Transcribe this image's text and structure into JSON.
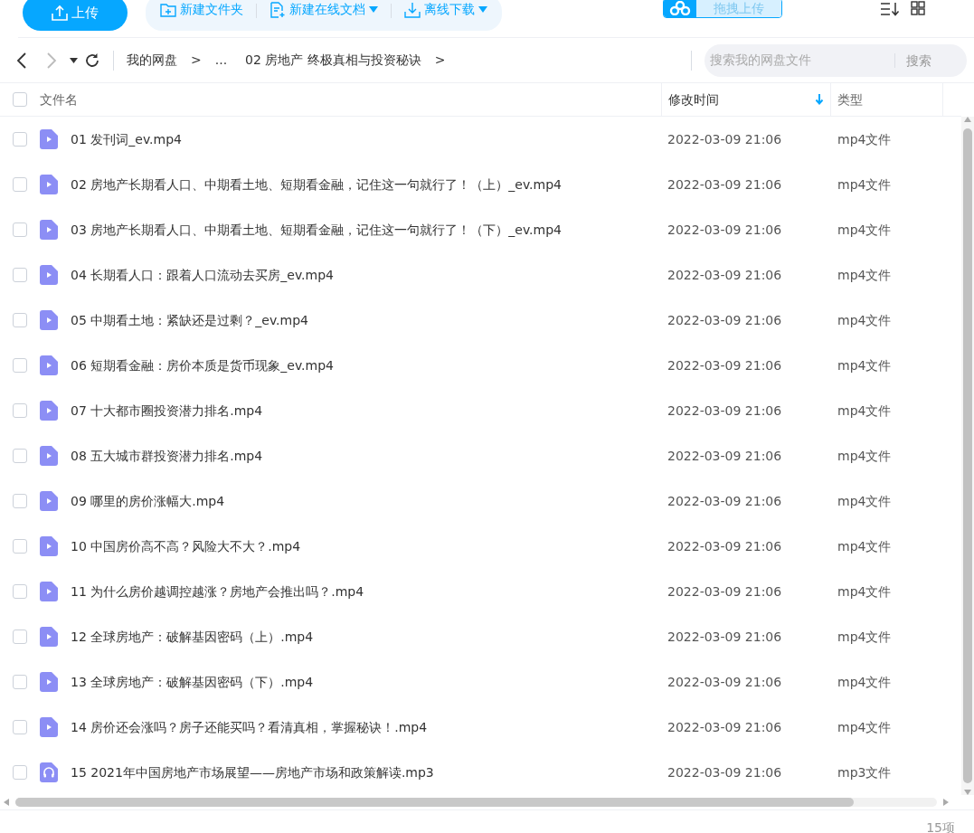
{
  "toolbar": {
    "upload": "上传",
    "actions": [
      {
        "kind": "folder",
        "label": "新建文件夹",
        "dropdown": false
      },
      {
        "kind": "doc",
        "label": "新建在线文档",
        "dropdown": true
      },
      {
        "kind": "download",
        "label": "离线下载",
        "dropdown": true
      }
    ],
    "drag_upload": "拖拽上传"
  },
  "nav": {
    "breadcrumb": [
      "我的网盘",
      ">",
      "...",
      "02 房地产 终极真相与投资秘诀",
      ">"
    ],
    "search": {
      "placeholder": "搜索我的网盘文件",
      "button": "搜索"
    }
  },
  "table": {
    "select_all_checked": false,
    "columns": [
      {
        "label": "文件名",
        "sorted": false
      },
      {
        "label": "修改时间",
        "sorted": true
      },
      {
        "label": "类型",
        "sorted": false
      }
    ],
    "rows": [
      {
        "name": "01 发刊词_ev.mp4",
        "kind": "video",
        "time": "2022-03-09 21:06",
        "type": "mp4文件",
        "checked": false
      },
      {
        "name": "02 房地产长期看人口、中期看土地、短期看金融，记住这一句就行了！（上）_ev.mp4",
        "kind": "video",
        "time": "2022-03-09 21:06",
        "type": "mp4文件",
        "checked": false
      },
      {
        "name": "03 房地产长期看人口、中期看土地、短期看金融，记住这一句就行了！（下）_ev.mp4",
        "kind": "video",
        "time": "2022-03-09 21:06",
        "type": "mp4文件",
        "checked": false
      },
      {
        "name": "04 长期看人口：跟着人口流动去买房_ev.mp4",
        "kind": "video",
        "time": "2022-03-09 21:06",
        "type": "mp4文件",
        "checked": false
      },
      {
        "name": "05 中期看土地：紧缺还是过剩？_ev.mp4",
        "kind": "video",
        "time": "2022-03-09 21:06",
        "type": "mp4文件",
        "checked": false
      },
      {
        "name": "06 短期看金融：房价本质是货币现象_ev.mp4",
        "kind": "video",
        "time": "2022-03-09 21:06",
        "type": "mp4文件",
        "checked": false
      },
      {
        "name": "07 十大都市圈投资潜力排名.mp4",
        "kind": "video",
        "time": "2022-03-09 21:06",
        "type": "mp4文件",
        "checked": false
      },
      {
        "name": "08 五大城市群投资潜力排名.mp4",
        "kind": "video",
        "time": "2022-03-09 21:06",
        "type": "mp4文件",
        "checked": false
      },
      {
        "name": "09 哪里的房价涨幅大.mp4",
        "kind": "video",
        "time": "2022-03-09 21:06",
        "type": "mp4文件",
        "checked": false
      },
      {
        "name": "10 中国房价高不高？风险大不大？.mp4",
        "kind": "video",
        "time": "2022-03-09 21:06",
        "type": "mp4文件",
        "checked": false
      },
      {
        "name": "11 为什么房价越调控越涨？房地产会推出吗？.mp4",
        "kind": "video",
        "time": "2022-03-09 21:06",
        "type": "mp4文件",
        "checked": false
      },
      {
        "name": "12 全球房地产：破解基因密码（上）.mp4",
        "kind": "video",
        "time": "2022-03-09 21:06",
        "type": "mp4文件",
        "checked": false
      },
      {
        "name": "13 全球房地产：破解基因密码（下）.mp4",
        "kind": "video",
        "time": "2022-03-09 21:06",
        "type": "mp4文件",
        "checked": false
      },
      {
        "name": "14 房价还会涨吗？房子还能买吗？看清真相，掌握秘诀！.mp4",
        "kind": "video",
        "time": "2022-03-09 21:06",
        "type": "mp4文件",
        "checked": false
      },
      {
        "name": "15 2021年中国房地产市场展望——房地产市场和政策解读.mp3",
        "kind": "audio",
        "time": "2022-03-09 21:06",
        "type": "mp3文件",
        "checked": false
      }
    ]
  },
  "status_bar": {
    "count": "15项"
  }
}
